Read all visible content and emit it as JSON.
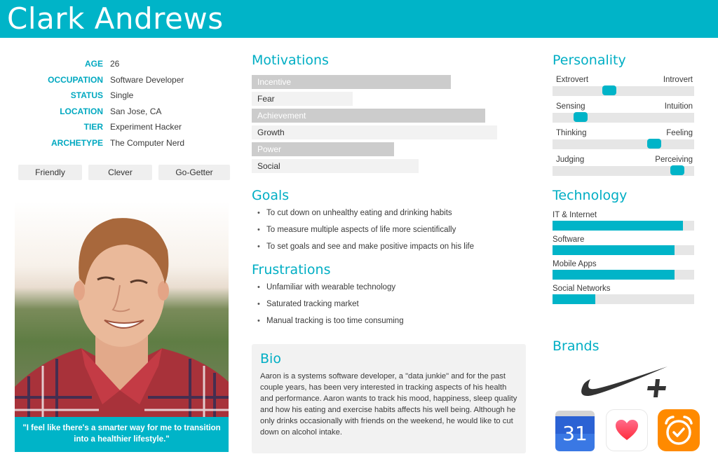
{
  "header": {
    "name": "Clark Andrews"
  },
  "colors": {
    "accent": "#00b4c8",
    "bar_dark": "#cccccc",
    "bar_light": "#f2f2f2",
    "track": "#e6e6e6"
  },
  "profile": {
    "fields": [
      {
        "label": "AGE",
        "value": "26"
      },
      {
        "label": "OCCUPATION",
        "value": "Software Developer"
      },
      {
        "label": "STATUS",
        "value": "Single"
      },
      {
        "label": "LOCATION",
        "value": "San Jose, CA"
      },
      {
        "label": "TIER",
        "value": "Experiment Hacker"
      },
      {
        "label": "ARCHETYPE",
        "value": "The Computer Nerd"
      }
    ],
    "traits": [
      "Friendly",
      "Clever",
      "Go-Getter"
    ],
    "photo": "portrait-photo",
    "quote": "\"I feel like there's a smarter way for me to transition into a healthier lifestyle.\""
  },
  "motivations": {
    "title": "Motivations",
    "items": [
      {
        "label": "Incentive",
        "value": 0.81,
        "style": "dark"
      },
      {
        "label": "Fear",
        "value": 0.41,
        "style": "light"
      },
      {
        "label": "Achievement",
        "value": 0.95,
        "style": "dark"
      },
      {
        "label": "Growth",
        "value": 1.0,
        "style": "light"
      },
      {
        "label": "Power",
        "value": 0.58,
        "style": "dark"
      },
      {
        "label": "Social",
        "value": 0.68,
        "style": "light"
      }
    ]
  },
  "goals": {
    "title": "Goals",
    "items": [
      "To cut down on unhealthy eating and drinking habits",
      "To measure multiple aspects of life more scientifically",
      "To set goals and see and make positive impacts on his life"
    ]
  },
  "frustrations": {
    "title": "Frustrations",
    "items": [
      "Unfamiliar with wearable technology",
      "Saturated tracking market",
      "Manual tracking is too time consuming"
    ]
  },
  "bio": {
    "title": "Bio",
    "text": "Aaron is a systems software developer, a \"data junkie\" and for the past couple years, has been very interested in tracking aspects of his health and performance. Aaron wants to track his mood, happiness, sleep quality and how his eating and exercise habits affects his well being. Although he only drinks occasionally with friends on the weekend, he would like to cut down on alcohol intake."
  },
  "personality": {
    "title": "Personality",
    "scales": [
      {
        "left": "Extrovert",
        "right": "Introvert",
        "value": 0.4
      },
      {
        "left": "Sensing",
        "right": "Intuition",
        "value": 0.2
      },
      {
        "left": "Thinking",
        "right": "Feeling",
        "value": 0.72
      },
      {
        "left": "Judging",
        "right": "Perceiving",
        "value": 0.88
      }
    ]
  },
  "technology": {
    "title": "Technology",
    "items": [
      {
        "label": "IT & Internet",
        "value": 0.92
      },
      {
        "label": "Software",
        "value": 0.86
      },
      {
        "label": "Mobile Apps",
        "value": 0.86
      },
      {
        "label": "Social Networks",
        "value": 0.3
      }
    ]
  },
  "brands": {
    "title": "Brands",
    "logos": [
      "nike-plus-logo",
      "google-calendar-icon",
      "apple-health-icon",
      "alarm-clock-app-icon"
    ],
    "calendar_day": "31"
  }
}
